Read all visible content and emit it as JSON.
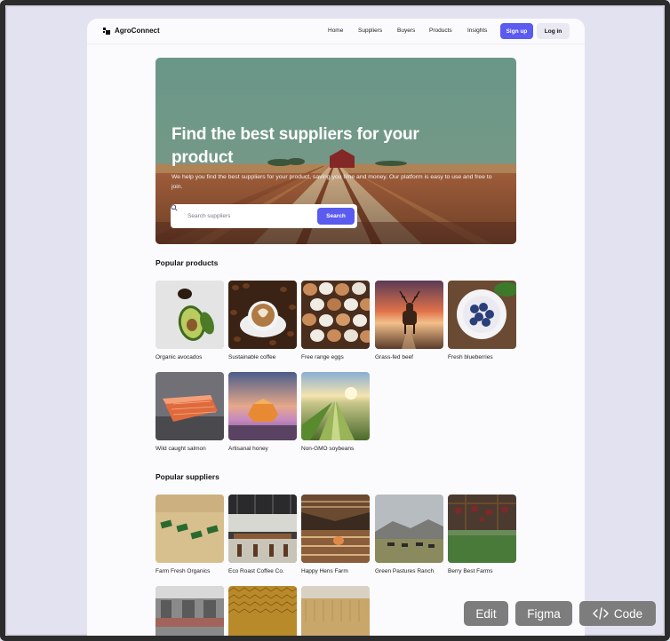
{
  "brand": {
    "name": "AgroConnect"
  },
  "nav": {
    "links": [
      "Home",
      "Suppliers",
      "Buyers",
      "Products",
      "Insights"
    ],
    "signup_label": "Sign up",
    "login_label": "Log in"
  },
  "hero": {
    "title": "Find the best suppliers for your product",
    "subtitle": "We help you find the best suppliers for your product, saving you time and money. Our platform is easy to use and free to join.",
    "search_placeholder": "Search suppliers",
    "search_button": "Search"
  },
  "popular_products": {
    "title": "Popular products",
    "items": [
      {
        "label": "Organic avocados",
        "icon": "avocado"
      },
      {
        "label": "Sustainable coffee",
        "icon": "coffee"
      },
      {
        "label": "Free range eggs",
        "icon": "eggs"
      },
      {
        "label": "Grass-fed beef",
        "icon": "stag"
      },
      {
        "label": "Fresh blueberries",
        "icon": "blueberries"
      },
      {
        "label": "Wild caught salmon",
        "icon": "salmon"
      },
      {
        "label": "Artisanal honey",
        "icon": "honey"
      },
      {
        "label": "Non-GMO soybeans",
        "icon": "field"
      }
    ]
  },
  "popular_suppliers": {
    "title": "Popular suppliers",
    "items": [
      {
        "label": "Farm Fresh Organics",
        "icon": "trays"
      },
      {
        "label": "Eco Roast Coffee Co.",
        "icon": "cafe"
      },
      {
        "label": "Happy Hens Farm",
        "icon": "henhouse"
      },
      {
        "label": "Green Pastures Ranch",
        "icon": "ranch"
      },
      {
        "label": "Berry Best Farms",
        "icon": "vineyard"
      },
      {
        "label": "",
        "icon": "market"
      },
      {
        "label": "",
        "icon": "honeycomb"
      },
      {
        "label": "",
        "icon": "wheat"
      }
    ]
  },
  "toolbar": {
    "edit_label": "Edit",
    "figma_label": "Figma",
    "code_label": "Code"
  },
  "colors": {
    "accent": "#5b5bf0",
    "background": "#e2e1f0",
    "page": "#fbfbfe",
    "toolbar_button": "#7d7d7d"
  }
}
